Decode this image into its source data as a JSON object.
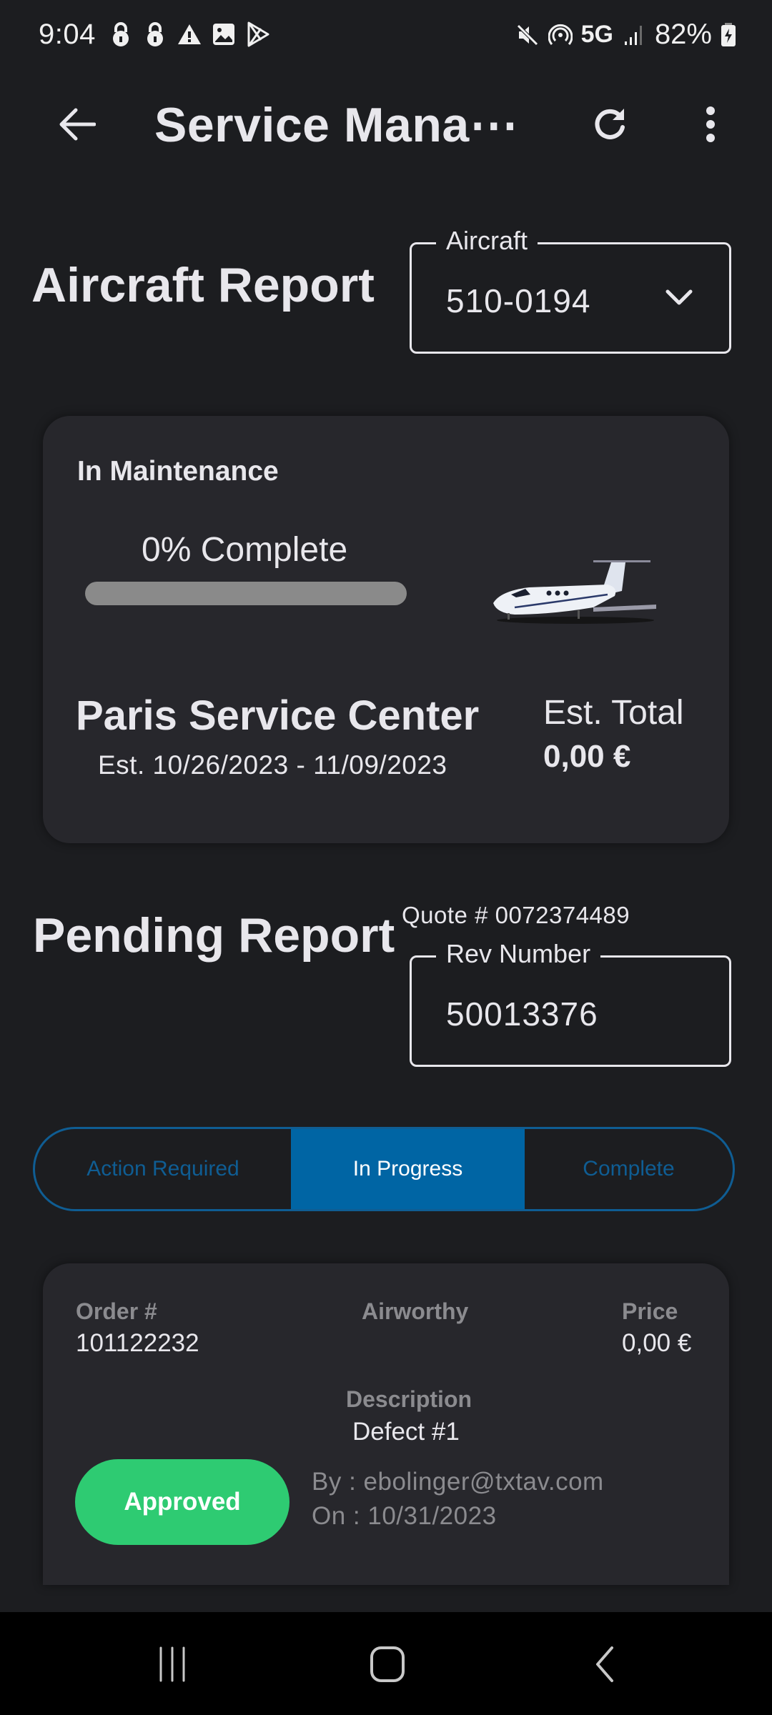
{
  "status_bar": {
    "time": "9:04",
    "left_icons": [
      "lock-icon",
      "lock-icon",
      "warning-icon",
      "image-icon",
      "play-store-icon"
    ],
    "right_icons": [
      "mute-icon",
      "hotspot-icon",
      "signal-icon",
      "battery-charging-icon"
    ],
    "network": "5G",
    "battery": "82%"
  },
  "app_bar": {
    "title": "Service Mana⋯",
    "back_icon": "arrow-left-icon",
    "refresh_icon": "refresh-icon",
    "more_icon": "more-vertical-icon"
  },
  "aircraft_report": {
    "title": "Aircraft Report",
    "aircraft_field": {
      "label": "Aircraft",
      "value": "510-0194"
    }
  },
  "maintenance_card": {
    "status": "In Maintenance",
    "progress_label": "0% Complete",
    "progress_percent": 0,
    "image": "aircraft-image",
    "service_center": "Paris Service Center",
    "dates": "Est. 10/26/2023 - 11/09/2023",
    "est_total_label": "Est. Total",
    "est_total_value": "0,00 €"
  },
  "pending_report": {
    "title": "Pending Report",
    "quote": "Quote # 0072374489",
    "rev_field": {
      "label": "Rev Number",
      "value": "50013376"
    }
  },
  "tabs": [
    {
      "label": "Action Required",
      "selected": false
    },
    {
      "label": "In Progress",
      "selected": true
    },
    {
      "label": "Complete",
      "selected": false
    }
  ],
  "order": {
    "order_label": "Order #",
    "order_value": "101122232",
    "airworthy_label": "Airworthy",
    "airworthy_value": "",
    "price_label": "Price",
    "price_value": "0,00 €",
    "description_label": "Description",
    "description_value": "Defect #1",
    "status_button": "Approved",
    "by": "By : ebolinger@txtav.com",
    "on": "On : 10/31/2023"
  },
  "colors": {
    "accent": "#0065a4",
    "approved": "#2ecb72",
    "background": "#1c1d20",
    "card": "#27272c"
  }
}
